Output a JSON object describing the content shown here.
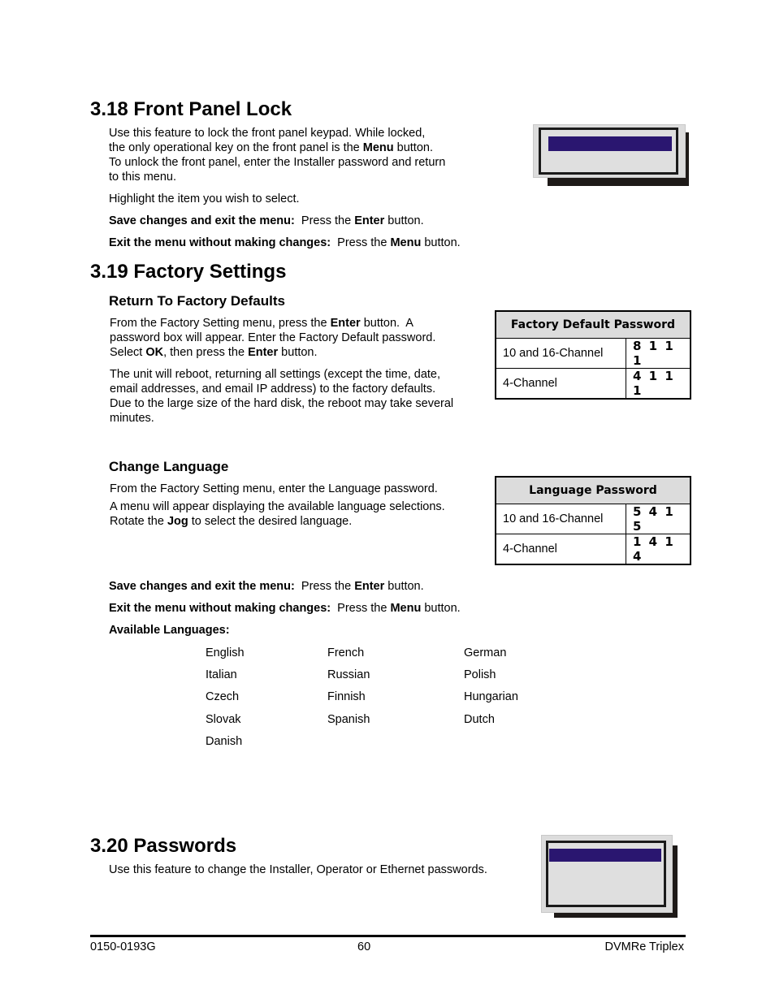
{
  "section_318": {
    "title": "3.18 Front Panel Lock",
    "para1": [
      {
        "t": "Use this feature to lock the front panel keypad.  While locked,"
      },
      {
        "t": "the only operational key on the front panel is the "
      },
      {
        "b": "Menu"
      },
      {
        "t": " button."
      }
    ],
    "line1": "Use this feature to lock the front panel keypad.  While locked,",
    "line2_pre": "the only operational key on the front panel is the ",
    "line2_bold": "Menu",
    "line2_post": " button.",
    "line3": "To unlock the front panel, enter the Installer password and return",
    "line4": "to this menu.",
    "highlight": "Highlight the item you wish to select.",
    "save_label": "Save changes and exit the menu:",
    "save_pre": "  Press the ",
    "save_key": "Enter",
    "save_post": " button.",
    "exit_label": "Exit the menu without making changes:",
    "exit_pre": "  Press the ",
    "exit_key": "Menu",
    "exit_post": " button."
  },
  "section_319": {
    "title": "3.19 Factory Settings",
    "sub1": {
      "title": "Return To Factory Defaults",
      "l1_pre": "From the Factory Setting menu, press the ",
      "l1_bold": "Enter",
      "l1_post": " button.  A",
      "l2": "password box will appear.  Enter the Factory Default password.",
      "l3_pre": "Select ",
      "l3_bold1": "OK",
      "l3_mid": ", then press the ",
      "l3_bold2": "Enter",
      "l3_post": " button.",
      "p2_l1": "The unit will reboot, returning all settings (except the time, date,",
      "p2_l2": "email addresses, and email IP address) to the factory defaults.",
      "p2_l3": "Due to the large size of the hard disk, the reboot may take several",
      "p2_l4": "minutes."
    },
    "factory_table": {
      "header": "Factory Default Password",
      "rows": [
        {
          "label": "10 and 16-Channel",
          "value": "8 1 1 1"
        },
        {
          "label": "4-Channel",
          "value": "4 1 1 1"
        }
      ]
    },
    "sub2": {
      "title": "Change Language",
      "l1": "From the Factory Setting menu, enter the Language password.",
      "l2": "A menu will appear displaying the available language selections.",
      "l3_pre": "Rotate the ",
      "l3_bold": "Jog",
      "l3_post": " to select the desired language."
    },
    "language_table": {
      "header": "Language Password",
      "rows": [
        {
          "label": "10 and 16-Channel",
          "value": "5 4 1 5"
        },
        {
          "label": "4-Channel",
          "value": "1 4 1 4"
        }
      ]
    },
    "save_label": "Save changes and exit the menu:",
    "save_pre": "  Press the ",
    "save_key": "Enter",
    "save_post": " button.",
    "exit_label": "Exit the menu without making changes:",
    "exit_pre": "  Press the ",
    "exit_key": "Menu",
    "exit_post": " button.",
    "languages_label": "Available Languages:",
    "languages": [
      [
        "English",
        "French",
        "German"
      ],
      [
        "Italian",
        "Russian",
        "Polish"
      ],
      [
        "Czech",
        "Finnish",
        "Hungarian"
      ],
      [
        "Slovak",
        "Spanish",
        "Dutch"
      ],
      [
        "Danish",
        "",
        ""
      ]
    ]
  },
  "section_320": {
    "title": "3.20 Passwords",
    "text": "Use this feature to change the Installer, Operator or Ethernet passwords."
  },
  "footer": {
    "doc_number": "0150-0193G",
    "page_number": "60",
    "product": "DVMRe Triplex"
  },
  "colors": {
    "menu_highlight": "#2a1670",
    "menu_background": "#dcdcdc",
    "table_header_bg": "#dcdcdc"
  }
}
